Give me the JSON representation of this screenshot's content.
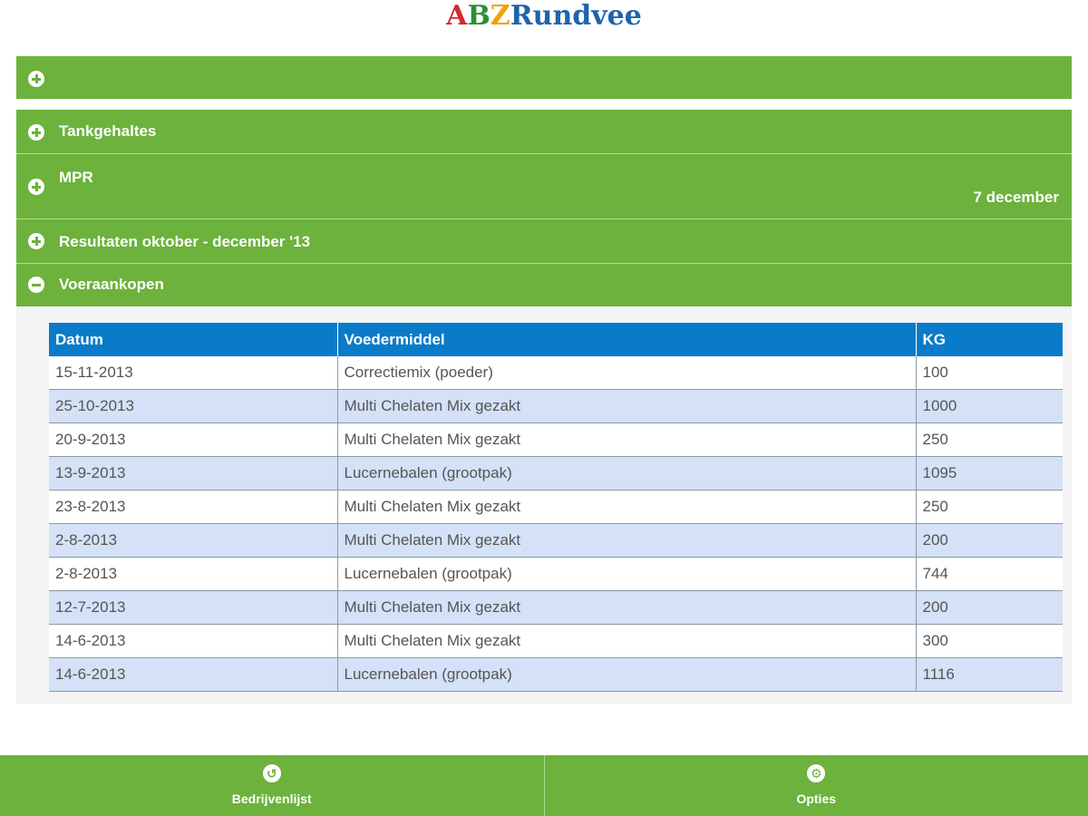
{
  "logo": {
    "letter_a": "A",
    "letter_b": "B",
    "letter_z": "Z",
    "rest": "Rundvee"
  },
  "accordion": {
    "top_section": {
      "label": "",
      "icon": "plus-icon"
    },
    "sections": [
      {
        "label": "Tankgehaltes",
        "icon": "plus-icon",
        "expanded": false
      },
      {
        "label": "MPR",
        "icon": "plus-icon",
        "expanded": false,
        "date": "7 december"
      },
      {
        "label": "Resultaten oktober - december '13",
        "icon": "plus-icon",
        "expanded": false
      },
      {
        "label": "Voeraankopen",
        "icon": "minus-icon",
        "expanded": true
      }
    ]
  },
  "table": {
    "headers": [
      "Datum",
      "Voedermiddel",
      "KG"
    ],
    "rows": [
      [
        "15-11-2013",
        "Correctiemix (poeder)",
        "100"
      ],
      [
        "25-10-2013",
        "Multi Chelaten Mix gezakt",
        "1000"
      ],
      [
        "20-9-2013",
        "Multi Chelaten Mix gezakt",
        "250"
      ],
      [
        "13-9-2013",
        "Lucernebalen (grootpak)",
        "1095"
      ],
      [
        "23-8-2013",
        "Multi Chelaten Mix gezakt",
        "250"
      ],
      [
        "2-8-2013",
        "Multi Chelaten Mix gezakt",
        "200"
      ],
      [
        "2-8-2013",
        "Lucernebalen (grootpak)",
        "744"
      ],
      [
        "12-7-2013",
        "Multi Chelaten Mix gezakt",
        "200"
      ],
      [
        "14-6-2013",
        "Multi Chelaten Mix gezakt",
        "300"
      ],
      [
        "14-6-2013",
        "Lucernebalen (grootpak)",
        "1116"
      ]
    ]
  },
  "footer": {
    "left_button": {
      "label": "Bedrijvenlijst",
      "icon": "back-icon",
      "glyph": "↺"
    },
    "right_button": {
      "label": "Opties",
      "icon": "gear-icon",
      "glyph": "⚙"
    }
  },
  "colors": {
    "green": "#6cb23c",
    "blue_header": "#0a7bc8",
    "row_alt": "#d4e1f7"
  }
}
